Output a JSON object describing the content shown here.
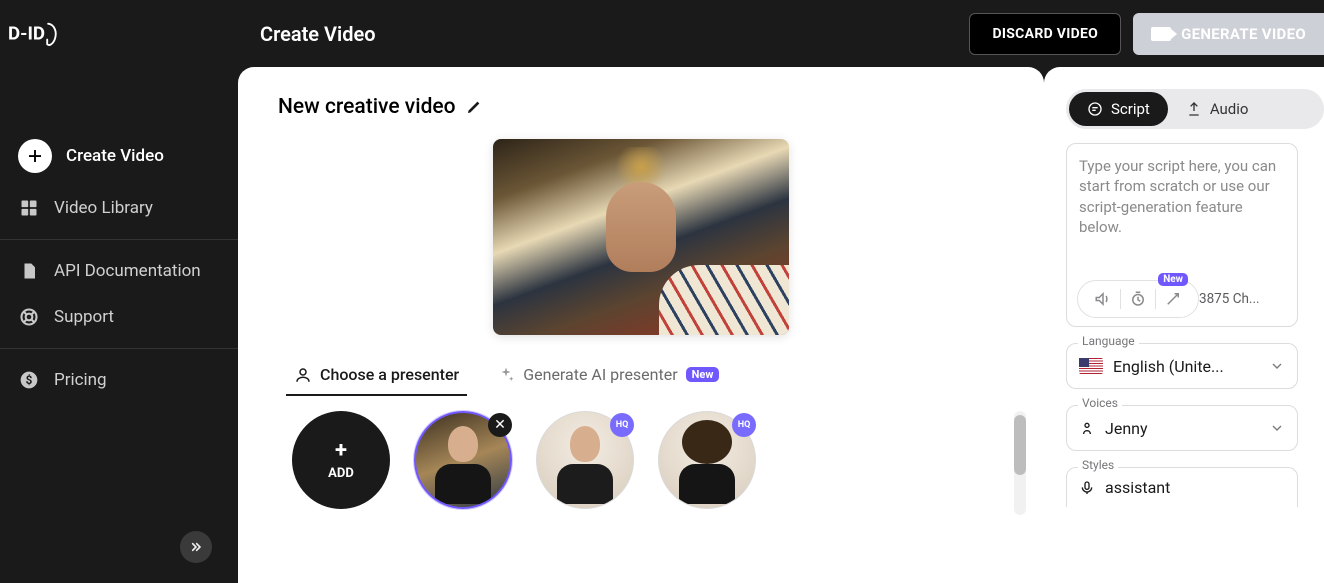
{
  "header": {
    "title": "Create Video",
    "discard_label": "DISCARD VIDEO",
    "generate_label": "GENERATE VIDEO"
  },
  "sidebar": {
    "items": [
      {
        "label": "Create Video",
        "icon": "plus"
      },
      {
        "label": "Video Library",
        "icon": "grid"
      },
      {
        "label": "API Documentation",
        "icon": "doc"
      },
      {
        "label": "Support",
        "icon": "lifebuoy"
      },
      {
        "label": "Pricing",
        "icon": "dollar"
      }
    ]
  },
  "stage": {
    "video_title": "New creative video",
    "tabs": {
      "choose": "Choose a presenter",
      "generate": "Generate AI presenter",
      "new_badge": "New"
    },
    "add_label": "ADD",
    "hq_badge": "HQ"
  },
  "script_panel": {
    "seg": {
      "script": "Script",
      "audio": "Audio"
    },
    "placeholder": "Type your script here, you can start from scratch or use our script-generation feature below.",
    "char_counter": "3875 Ch...",
    "toolbar_new": "New",
    "language_label": "Language",
    "language_value": "English (Unite...",
    "voices_label": "Voices",
    "voices_value": "Jenny",
    "styles_label": "Styles",
    "styles_value": "assistant"
  }
}
